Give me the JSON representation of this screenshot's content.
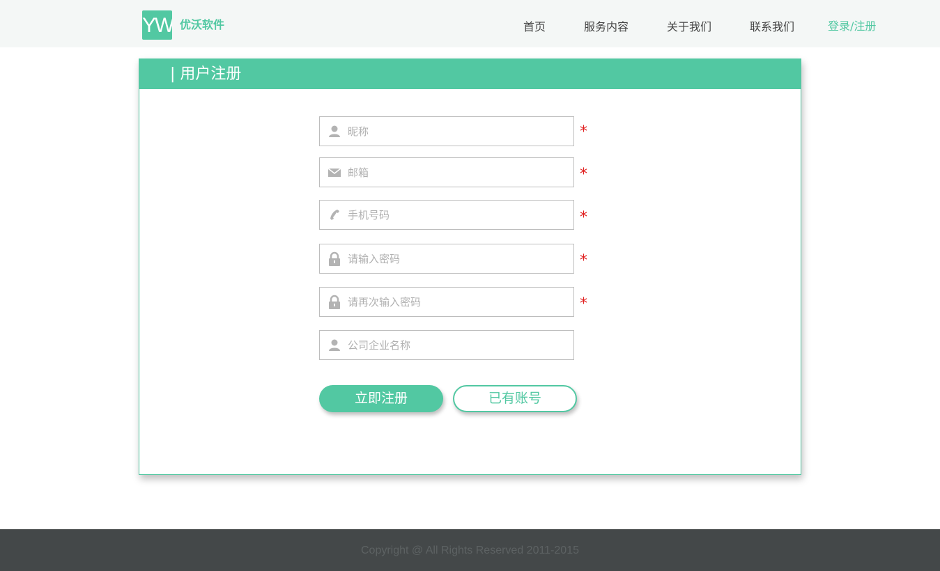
{
  "header": {
    "logo_letters": "YW",
    "brand_name": "优沃软件",
    "nav": [
      {
        "label": "首页"
      },
      {
        "label": "服务内容"
      },
      {
        "label": "关于我们"
      },
      {
        "label": "联系我们"
      },
      {
        "label": "登录/注册"
      }
    ],
    "active_color": "#52c8a2"
  },
  "card": {
    "title": "| 用户注册",
    "accent_color": "#52c8a2"
  },
  "form": {
    "fields": [
      {
        "icon": "user-icon",
        "placeholder": "昵称",
        "value": "",
        "required": true
      },
      {
        "icon": "envelope-icon",
        "placeholder": "邮箱",
        "value": "",
        "required": true
      },
      {
        "icon": "phone-icon",
        "placeholder": "手机号码",
        "value": "",
        "required": true
      },
      {
        "icon": "lock-icon",
        "placeholder": "请输入密码",
        "value": "",
        "required": true
      },
      {
        "icon": "lock-icon",
        "placeholder": "请再次输入密码",
        "value": "",
        "required": true
      },
      {
        "icon": "user-icon",
        "placeholder": "公司企业名称",
        "value": "",
        "required": false
      }
    ],
    "required_mark": "*",
    "required_color": "#e02020",
    "register_label": "立即注册",
    "have_account_label": "已有账号"
  },
  "footer": {
    "copyright": "Copyright @ All Rights Reserved 2011-2015"
  }
}
